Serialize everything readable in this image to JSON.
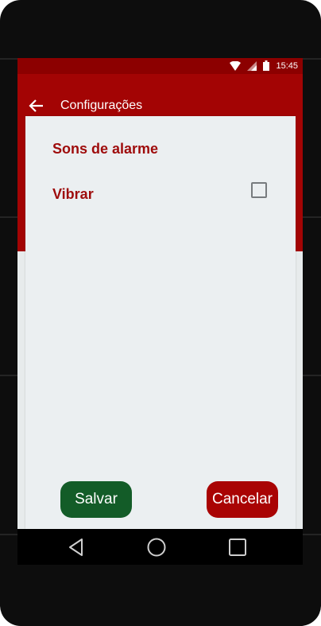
{
  "status_bar": {
    "time": "15:45"
  },
  "app_bar": {
    "title": "Configurações"
  },
  "settings": {
    "section_title": "Sons de alarme",
    "vibrate_label": "Vibrar",
    "vibrate_checked": false
  },
  "buttons": {
    "save": "Salvar",
    "cancel": "Cancelar"
  },
  "icons": {
    "back": "arrow-left-icon",
    "wifi": "wifi-icon",
    "signal": "signal-icon",
    "battery": "battery-icon",
    "nav_back": "triangle-back-icon",
    "nav_home": "circle-home-icon",
    "nav_recents": "square-recents-icon"
  },
  "colors": {
    "primary": "#a30404",
    "primary_dark": "#8c0000",
    "accent_text": "#9e0b0b",
    "save_button": "#135c28",
    "cancel_button": "#a90404"
  }
}
